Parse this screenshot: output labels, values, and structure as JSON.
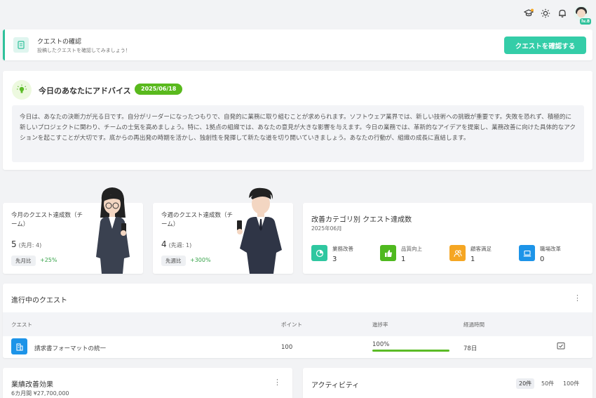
{
  "header": {
    "avatar_badge": "lv.8"
  },
  "quest_confirm": {
    "title": "クエストの確認",
    "subtitle": "投稿したクエストを確認してみましょう！",
    "button": "クエストを確認する"
  },
  "advice": {
    "title": "今日のあなたにアドバイス",
    "date": "2025/06/18",
    "body": "今日は、あなたの決断力が光る日です。自分がリーダーになったつもりで、自発的に業務に取り組むことが求められます。ソフトウェア業界では、新しい技術への挑戦が重要です。失敗を恐れず、積極的に新しいプロジェクトに関わり、チームの士気を高めましょう。特に、1拠点の組織では、あなたの意見が大きな影響を与えます。今日の業務では、革新的なアイデアを提案し、業務改善に向けた具体的なアクションを起こすことが大切です。底からの再出発の時期を活かし、独創性を発揮して新たな道を切り開いていきましょう。あなたの行動が、組織の成長に直結します。"
  },
  "stats": {
    "monthly": {
      "label": "今月のクエスト達成数（チーム）",
      "value": "5",
      "prev": "(先月: 4)",
      "compare": "先月比",
      "change": "+25%"
    },
    "weekly": {
      "label": "今週のクエスト達成数（チーム）",
      "value": "4",
      "prev": "(先週: 1)",
      "compare": "先週比",
      "change": "+300%"
    }
  },
  "category": {
    "title": "改善カテゴリ別 クエスト達成数",
    "period": "2025年06月",
    "items": [
      {
        "name": "業務改善",
        "value": "3",
        "color": "#2fc7a0"
      },
      {
        "name": "品質向上",
        "value": "1",
        "color": "#4fb91f"
      },
      {
        "name": "顧客満足",
        "value": "1",
        "color": "#f5a623"
      },
      {
        "name": "職場改革",
        "value": "0",
        "color": "#1d94e8"
      }
    ]
  },
  "progress": {
    "title": "進行中のクエスト",
    "columns": [
      "クエスト",
      "ポイント",
      "進捗率",
      "経過時間"
    ],
    "rows": [
      {
        "quest": "請求書フォーマットの統一",
        "points": "100",
        "rate": "100%",
        "elapsed": "78日",
        "rate_fraction": 1.0
      }
    ]
  },
  "gains": {
    "title": "業績改善効果",
    "subtitle": "6カ月間 ¥27,700,000"
  },
  "activity": {
    "title": "アクティビティ",
    "filters": [
      "20件",
      "50件",
      "100件"
    ]
  }
}
